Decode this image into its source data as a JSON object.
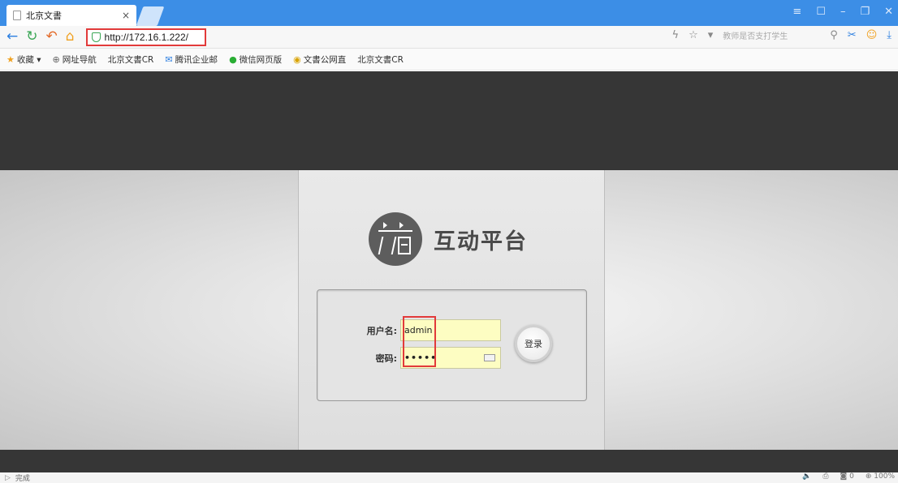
{
  "browser": {
    "tab_title": "北京文書",
    "tab_close": "×",
    "url": "http://172.16.1.222/",
    "search_hint": "教师是否支打学生",
    "window_controls": [
      "≡",
      "☐",
      "–",
      "❐",
      "✕"
    ]
  },
  "bookmarks": [
    {
      "icon": "star-icon",
      "label": "收藏 ▾"
    },
    {
      "icon": "globe-icon",
      "label": "网址导航"
    },
    {
      "icon": "page-icon",
      "label": "北京文書CR"
    },
    {
      "icon": "mail-icon",
      "label": "腾讯企业邮"
    },
    {
      "icon": "wechat-icon",
      "label": "微信网页版"
    },
    {
      "icon": "gov-icon",
      "label": "文書公网直"
    },
    {
      "icon": "page-icon",
      "label": "北京文書CR"
    }
  ],
  "page": {
    "brand": "互动平台",
    "username_label": "用户名:",
    "username_value": "admin",
    "password_label": "密码:",
    "password_value": "•••••",
    "login_button": "登录"
  },
  "status": {
    "left": "完成",
    "right_items": [
      "🔈",
      "⎙",
      "◙ 0",
      "⊕ 100%"
    ]
  }
}
